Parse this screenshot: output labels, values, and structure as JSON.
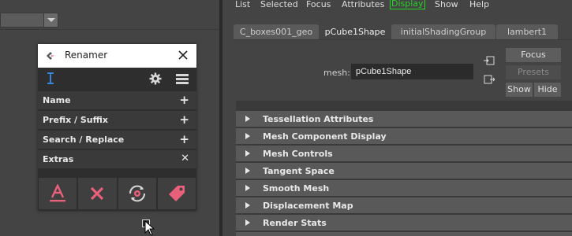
{
  "renamer": {
    "title": "Renamer",
    "sections": [
      {
        "label": "Name",
        "symbol": "+"
      },
      {
        "label": "Prefix / Suffix",
        "symbol": "+"
      },
      {
        "label": "Search / Replace",
        "symbol": "+"
      },
      {
        "label": "Extras",
        "symbol": "✕"
      }
    ],
    "accent": "#e8607a",
    "cursor_color": "#3a8ee6"
  },
  "attribute_editor": {
    "menu": [
      "List",
      "Selected",
      "Focus",
      "Attributes",
      "Display",
      "Show",
      "Help"
    ],
    "active_menu": "Display",
    "tabs": [
      "C_boxes001_geo",
      "pCube1Shape",
      "initialShadingGroup",
      "lambert1"
    ],
    "selected_tab": "pCube1Shape",
    "mesh_label": "mesh:",
    "mesh_value": "pCube1Shape",
    "buttons": {
      "focus": "Focus",
      "presets": "Presets",
      "show": "Show",
      "hide": "Hide"
    },
    "frame_layouts": [
      "Tessellation Attributes",
      "Mesh Component Display",
      "Mesh Controls",
      "Tangent Space",
      "Smooth Mesh",
      "Displacement Map",
      "Render Stats"
    ]
  },
  "colors": {
    "highlight": "#23d423"
  }
}
